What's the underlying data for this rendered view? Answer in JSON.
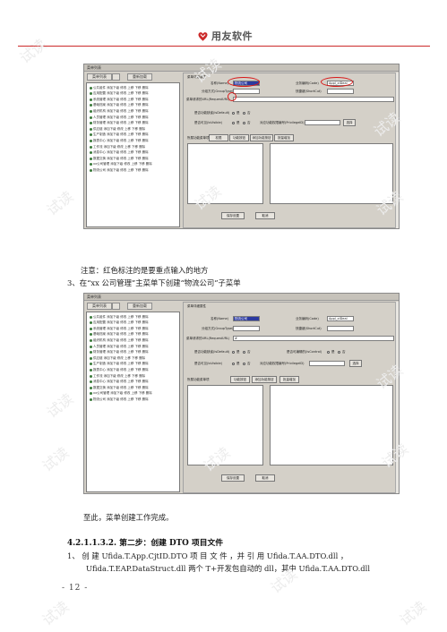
{
  "header": {
    "logo_text": "用友软件"
  },
  "screenshot1": {
    "toolbar": [
      "菜单列表",
      "",
      "重新加载"
    ],
    "tree_rows": [
      "公共组件 添加下级 修改 上移 下移 删除",
      "应用配置 添加下级 修改 上移 下移 删除",
      "系统管理 添加下级 修改 上移 下移 删除",
      "基础档案 添加下级 修改 上移 下移 删除",
      "组织机构 添加下级 修改 上移 下移 删除",
      "人员管理 添加下级 修改 上移 下移 删除",
      "财务管理 添加下级 修改 上移 下移 删除",
      "供应链 添加下级 修改 上移 下移 删除",
      "生产制造 添加下级 修改 上移 下移 删除",
      "报表中心 添加下级 修改 上移 下移 删除",
      "工作流 添加下级 修改 上移 下移 删除",
      "消息中心 添加下级 修改 上移 下移 删除",
      "数据交换 添加下级 修改 上移 下移 删除",
      "xx公司管理 添加下级 修改 上移 下移 删除",
      "物流公司 添加下级 修改 上移 下移 删除"
    ],
    "form": {
      "section": "菜单详细属性",
      "name_label": "名称(Name)",
      "name_value": "物流公司",
      "code_label": "业务编码(Code)",
      "code_value": "Appl_xlDeal",
      "group_label": "分组方式(GroupType)",
      "shortcut_label": "快捷键(ShortCut)",
      "url_label": "菜单请求的URL(RequestURL)",
      "default_label": "是否功能缺省(IsDefault)",
      "yes": "是",
      "no": "否",
      "visible_label": "是否可见(IsVisible)",
      "priv_label": "对应功能权限编号(PrivilegeID)",
      "choose": "选择",
      "tabs": [
        "权限",
        "功能按钮",
        "添加功能按钮",
        "按量增加"
      ],
      "sub_label": "所属功能菜单项",
      "save": "保存设置",
      "cancel": "取消"
    }
  },
  "note": "注意：红色标注的是要重点输入的地方",
  "step3": "3、在“xx 公司管理”主菜单下创建“物流公司”子菜单",
  "screenshot2": {
    "toolbar": [
      "菜单列表",
      "",
      "重新加载"
    ],
    "form": {
      "section": "菜单详细属性",
      "name_label": "名称(Name)",
      "name_value": "物流公司",
      "code_label": "业务编码(Code)",
      "code_value": "Appl_xlDeal",
      "group_label": "分组方式(GroupType)",
      "shortcut_label": "快捷键(ShortCut)",
      "url_label": "菜单请求的URL(RequestURL)",
      "url_value": "#",
      "default_label": "是否功能缺省(IsDefault)",
      "yes": "是",
      "no": "否",
      "default_label2": "是否可编辑的(IsControl)",
      "visible_label": "是否可见(IsVisible)",
      "priv_label": "对应功能权限编号(PrivilegeID)",
      "choose": "选择",
      "tabs": [
        "功能按钮",
        "添加功能按钮",
        "批量增加"
      ],
      "sub_label": "所属功能菜单项",
      "save": "保存设置",
      "cancel": "取消"
    }
  },
  "done": "至此，菜单创建工作完成。",
  "heading": "4.2.1.1.3.2. 第二步：创建 DTO 项目文件",
  "step1_line1": "1、 创 建  Ufida.T.App.CjtID.DTO  项 目 文 件 ，并 引 用  Ufida.T.AA.DTO.dll  ，",
  "step1_line2": "Ufida.T.EAP.DataStruct.dll 两个 T+开发包自动的 dll，其中 Ufida.T.AA.DTO.dll",
  "footer": "- 12 -",
  "watermark": "试读",
  "colors": {
    "brand_red": "#cc2a2a",
    "annotation_red": "#d81818",
    "selection_blue": "#2c3aa0"
  }
}
